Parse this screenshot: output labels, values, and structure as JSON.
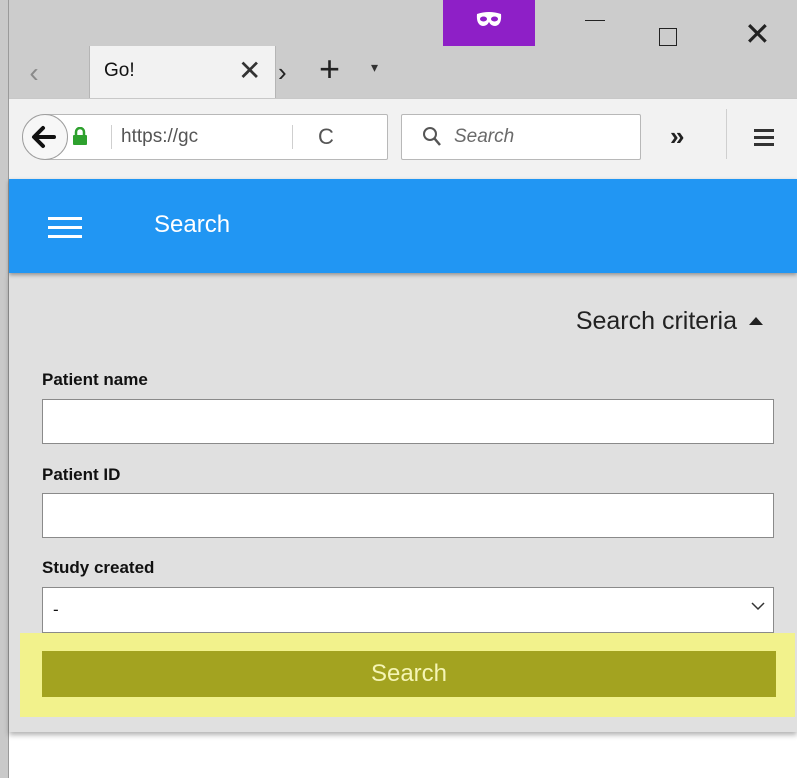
{
  "browser": {
    "tab_title": "Go!",
    "tab_close_glyph": "✕",
    "tab_scroll_glyph": "‹",
    "tab_forward_glyph": "›",
    "new_tab_glyph": "+",
    "tab_list_glyph": "▾",
    "url_text": "https://gc",
    "search_placeholder": "Search",
    "overflow_glyph": "»",
    "close_glyph": "✕",
    "reload_glyph": "C",
    "colors": {
      "private_mask": "#8e1fc7",
      "secure_lock": "#2ea12e"
    }
  },
  "app": {
    "title": "Search",
    "colors": {
      "appbar": "#2196f3",
      "panel": "#e0e0e0",
      "search_button": "#a3a320",
      "highlight": "#f2f28c"
    }
  },
  "form": {
    "criteria_toggle_label": "Search criteria",
    "patient_name_label": "Patient name",
    "patient_name_value": "",
    "patient_id_label": "Patient ID",
    "patient_id_value": "",
    "study_created_label": "Study created",
    "study_created_value": "-",
    "search_button_label": "Search"
  },
  "icons": [
    "back-arrow-icon",
    "lock-icon",
    "reload-icon",
    "search-icon",
    "overflow-icon",
    "menu-icon",
    "hamburger-icon",
    "chevron-down-icon",
    "private-mask-icon"
  ]
}
